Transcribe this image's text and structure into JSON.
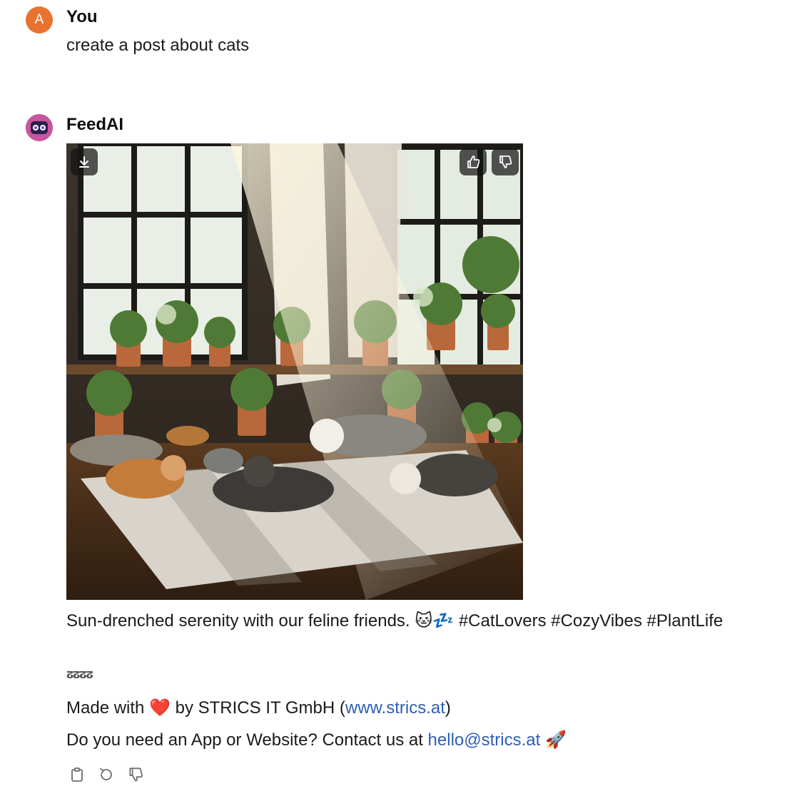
{
  "user": {
    "initial": "A",
    "name": "You",
    "message": "create a post about cats"
  },
  "bot": {
    "name": "FeedAI",
    "caption": "Sun-drenched serenity with our feline friends. 🐱💤 #CatLovers #CozyVibes #PlantLife",
    "separator": "ⵒⵒⵒⵒ",
    "made_with_prefix": "Made with ",
    "heart": "❤️",
    "made_with_by": " by STRICS IT GmbH (",
    "made_with_link": "www.strics.at",
    "made_with_suffix": ")",
    "contact_prefix": "Do you need an App or Website? Contact us at ",
    "contact_email": "hello@strics.at",
    "contact_suffix": " 🚀"
  },
  "icons": {
    "download": "download-icon",
    "thumbs_up": "thumbs-up-icon",
    "thumbs_down": "thumbs-down-icon",
    "copy": "clipboard-icon",
    "regenerate": "regenerate-icon"
  },
  "colors": {
    "user_avatar": "#e8722f",
    "bot_avatar": "#d15fa5",
    "link": "#2f5fb3"
  }
}
